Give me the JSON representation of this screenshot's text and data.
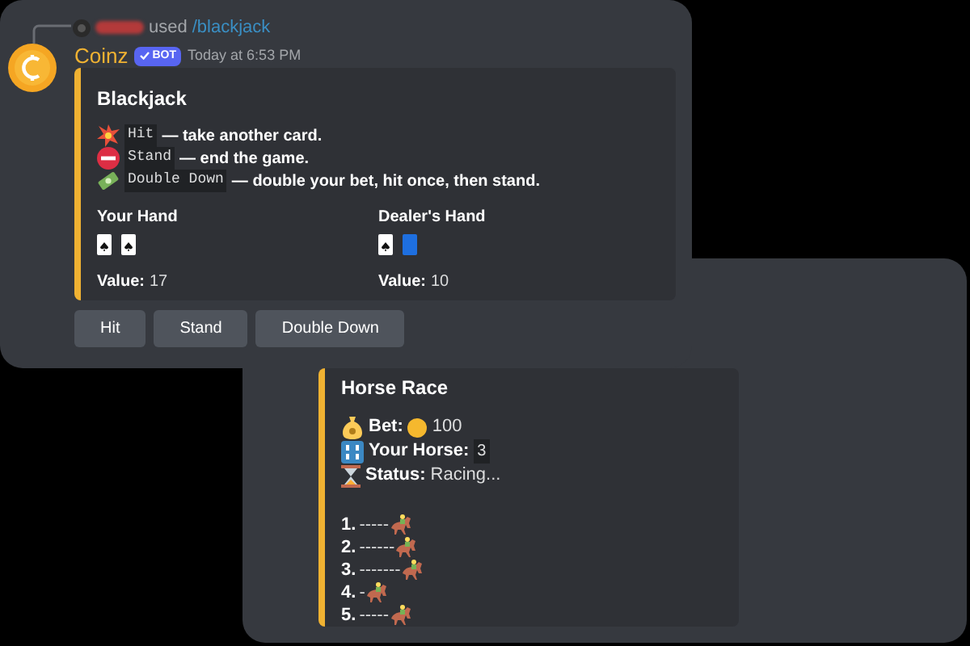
{
  "reply": {
    "verb": "used",
    "command": "/blackjack"
  },
  "message": {
    "author": "Coinz",
    "badge": "BOT",
    "timestamp": "Today at 6:53 PM"
  },
  "embed": {
    "title": "Blackjack",
    "actions": [
      {
        "kind": "collision",
        "key": "Hit",
        "text": "— take another card."
      },
      {
        "kind": "stop",
        "key": "Stand",
        "text": "— end the game."
      },
      {
        "kind": "money",
        "key": "Double Down",
        "text": "— double your bet, hit once, then stand."
      }
    ],
    "hands": [
      {
        "title": "Your Hand",
        "cards": [
          {
            "face_up": true
          },
          {
            "face_up": true
          }
        ],
        "value_label": "Value:",
        "value": "17"
      },
      {
        "title": "Dealer's Hand",
        "cards": [
          {
            "face_up": true
          },
          {
            "face_up": false
          }
        ],
        "value_label": "Value:",
        "value": "10"
      }
    ]
  },
  "buttons": [
    "Hit",
    "Stand",
    "Double Down"
  ],
  "race": {
    "title": "Horse Race",
    "fields": [
      {
        "kind": "bet",
        "label": "Bet:",
        "value": "100"
      },
      {
        "kind": "horse",
        "label": "Your Horse:",
        "value": "3"
      },
      {
        "kind": "status",
        "label": "Status:",
        "value": "Racing..."
      }
    ],
    "lanes": [
      {
        "number": "1.",
        "track": "-----"
      },
      {
        "number": "2.",
        "track": "------"
      },
      {
        "number": "3.",
        "track": "-------"
      },
      {
        "number": "4.",
        "track": "-"
      },
      {
        "number": "5.",
        "track": "-----"
      }
    ]
  }
}
